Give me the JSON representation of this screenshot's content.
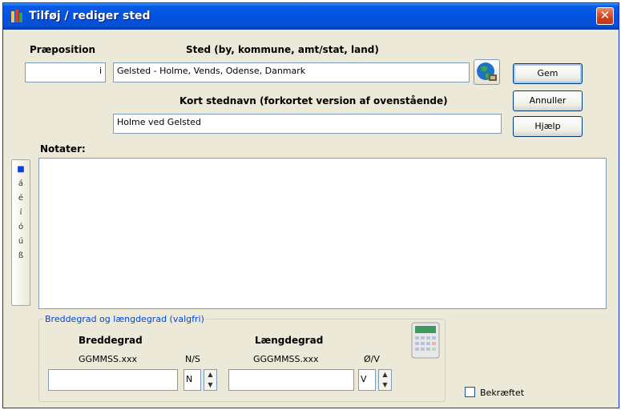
{
  "window": {
    "title": "Tilføj / rediger sted",
    "close_label": "✕"
  },
  "labels": {
    "preposition": "Præposition",
    "place": "Sted (by, kommune, amt/stat, land)",
    "short_name": "Kort stednavn (forkortet version af ovenstående)",
    "notes": "Notater:"
  },
  "fields": {
    "preposition_value": "i",
    "place_value": "Gelsted - Holme, Vends, Odense, Danmark",
    "short_name_value": "Holme ved Gelsted"
  },
  "buttons": {
    "save": "Gem",
    "cancel": "Annuller",
    "help": "Hjælp"
  },
  "sidebar_chars": [
    "■",
    "á",
    "é",
    "í",
    "ó",
    "ú",
    "ß"
  ],
  "coords": {
    "group_title": "Breddegrad og længdegrad (valgfri)",
    "latitude_label": "Breddegrad",
    "latitude_format": "GGMMSS.xxx",
    "ns_label": "N/S",
    "ns_value": "N",
    "longitude_label": "Længdegrad",
    "longitude_format": "GGGMMSS.xxx",
    "ew_label": "Ø/V",
    "ew_value": "V",
    "latitude_value": "",
    "longitude_value": ""
  },
  "checkbox": {
    "label": "Bekræftet",
    "checked": false
  },
  "icons": {
    "app": "place-icon",
    "globe": "globe-icon",
    "calculator": "calculator-icon"
  }
}
